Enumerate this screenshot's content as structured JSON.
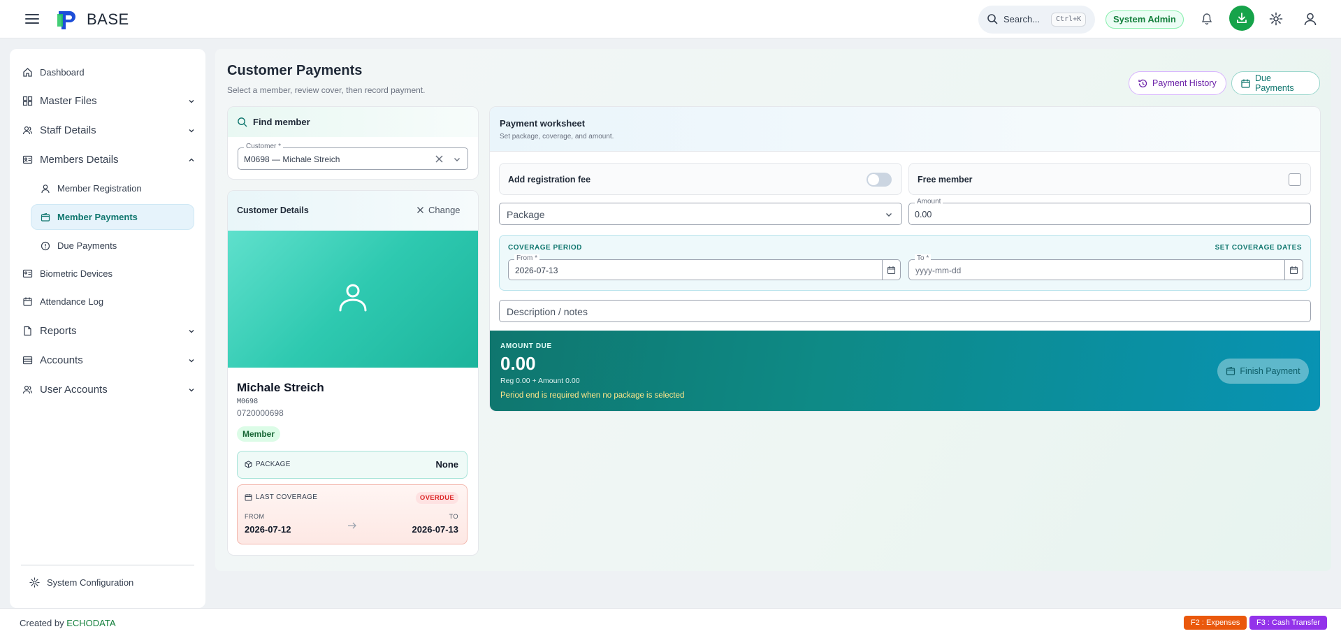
{
  "header": {
    "brand": "BASE",
    "search_label": "Search...",
    "search_shortcut": "Ctrl+K",
    "role": "System Admin",
    "icons": [
      "menu-icon",
      "bell-icon",
      "download-icon",
      "gear-icon",
      "user-icon"
    ]
  },
  "sidebar": {
    "items": [
      {
        "label": "Dashboard",
        "icon": "home-icon"
      },
      {
        "label": "Master Files",
        "icon": "grid-icon"
      },
      {
        "label": "Staff Details",
        "icon": "users-icon"
      },
      {
        "label": "Members Details",
        "icon": "id-card-icon"
      },
      {
        "label": "Member Registration",
        "icon": "user-icon"
      },
      {
        "label": "Member Payments",
        "icon": "wallet-icon"
      },
      {
        "label": "Due Payments",
        "icon": "alert-circle-icon"
      },
      {
        "label": "Biometric Devices",
        "icon": "id-card-icon"
      },
      {
        "label": "Attendance Log",
        "icon": "calendar-icon"
      },
      {
        "label": "Reports",
        "icon": "file-icon"
      },
      {
        "label": "Accounts",
        "icon": "layers-icon"
      },
      {
        "label": "User Accounts",
        "icon": "users-icon"
      }
    ],
    "system_config": "System Configuration"
  },
  "page": {
    "title": "Customer Payments",
    "subtitle": "Select a member, review cover, then record payment.",
    "payment_history": "Payment History",
    "due_payments": "Due Payments"
  },
  "find_member": {
    "title": "Find member",
    "customer_label": "Customer *",
    "customer_value": "M0698 — Michale Streich"
  },
  "customer_details": {
    "title": "Customer Details",
    "change": "Change",
    "name": "Michale Streich",
    "member_id": "M0698",
    "phone": "0720000698",
    "badge": "Member",
    "package_label": "PACKAGE",
    "package_value": "None",
    "last_coverage_label": "LAST COVERAGE",
    "status": "OVERDUE",
    "from_label": "FROM",
    "from": "2026-07-12",
    "to_label": "TO",
    "to": "2026-07-13"
  },
  "worksheet": {
    "title": "Payment worksheet",
    "subtitle": "Set package, coverage, and amount.",
    "reg_fee_label": "Add registration fee",
    "free_member_label": "Free member",
    "package_placeholder": "Package",
    "amount_label": "Amount",
    "amount_value": "0.00",
    "coverage_title": "COVERAGE PERIOD",
    "set_coverage": "SET COVERAGE DATES",
    "from_label": "From *",
    "from_value": "2026-07-13",
    "to_label": "To *",
    "to_placeholder": "yyyy-mm-dd",
    "notes_placeholder": "Description / notes"
  },
  "amount_due": {
    "label": "AMOUNT DUE",
    "value": "0.00",
    "breakdown": "Reg 0.00 + Amount 0.00",
    "warning": "Period end is required when no package is selected",
    "finish": "Finish Payment"
  },
  "footer": {
    "credit_prefix": "Created by",
    "credit_brand": "ECHODATA",
    "f2": "F2 : Expenses",
    "f3": "F3 : Cash Transfer"
  },
  "colors": {
    "accent": "#15803d",
    "teal": "#0f766e",
    "purple": "#6b21a8",
    "f2": "#ea580c",
    "f3": "#9333ea"
  }
}
